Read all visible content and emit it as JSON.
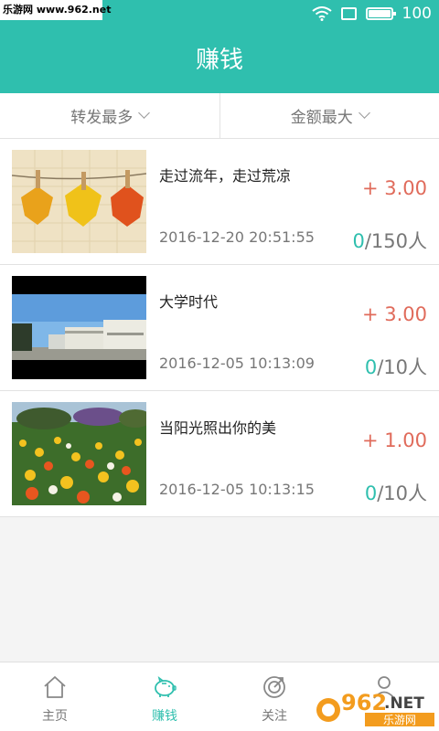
{
  "status_bar": {
    "watermark": "乐游网 www.962.net",
    "battery": "100",
    "battery_level": 1.0
  },
  "app_bar": {
    "title": "赚钱"
  },
  "filters": [
    {
      "label": "转发最多",
      "icon": "chevron-down-icon"
    },
    {
      "label": "金额最大",
      "icon": "chevron-down-icon"
    }
  ],
  "items": [
    {
      "title": "走过流年，走过荒凉",
      "amount": "+ 3.00",
      "date": "2016-12-20 20:51:55",
      "done": "0",
      "total": "/150人",
      "image": "autumn-leaves-on-clothesline"
    },
    {
      "title": "大学时代",
      "amount": "+ 3.00",
      "date": "2016-12-05 10:13:09",
      "done": "0",
      "total": "/10人",
      "image": "campus-building"
    },
    {
      "title": "当阳光照出你的美",
      "amount": "+ 1.00",
      "date": "2016-12-05 10:13:15",
      "done": "0",
      "total": "/10人",
      "image": "flower-field"
    }
  ],
  "tabs": [
    {
      "label": "主页",
      "icon": "home-icon",
      "active": false
    },
    {
      "label": "赚钱",
      "icon": "piggy-bank-icon",
      "active": true
    },
    {
      "label": "关注",
      "icon": "target-icon",
      "active": false
    },
    {
      "label": "",
      "icon": "user-icon",
      "active": false
    }
  ],
  "watermark_logo": {
    "main": "962",
    "suffix": ".NET",
    "sub": "乐游网"
  },
  "colors": {
    "accent": "#2fbfae",
    "amount": "#e06b5b"
  }
}
